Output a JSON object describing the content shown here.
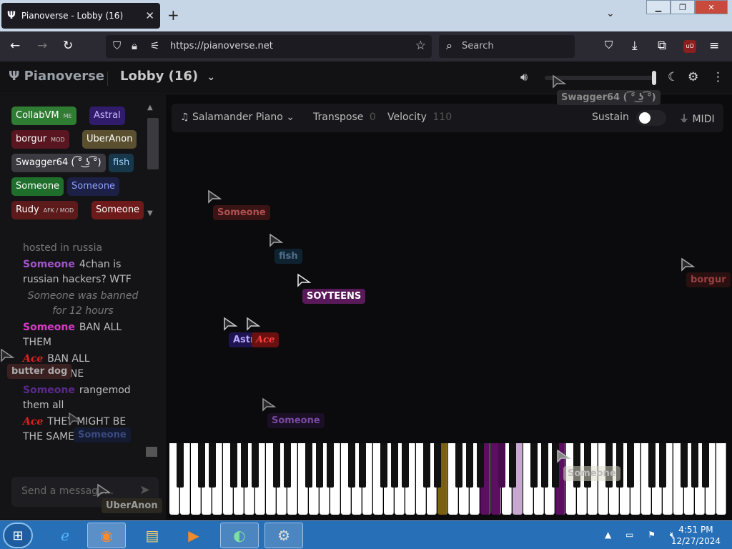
{
  "browser": {
    "tab_title": "Pianoverse - Lobby (16)",
    "tab_favicon": "Ψ",
    "url": "https://pianoverse.net",
    "search_placeholder": "Search"
  },
  "app": {
    "brand": "Pianoverse",
    "room": "Lobby (16)",
    "volume_level": 1.0,
    "volume_label": "Swagger64 ( ͡° ͜ʖ ͡°)"
  },
  "users": [
    {
      "name": "CollabVM",
      "tag": "ME",
      "color": "#2e7d32",
      "text": "#ffffff"
    },
    {
      "name": "Astral",
      "tag": "",
      "color": "#311b6b",
      "text": "#c9b8ff"
    },
    {
      "name": "borgur",
      "tag": "MOD",
      "color": "#5a1620",
      "text": "#ffffff"
    },
    {
      "name": "UberAnon",
      "tag": "",
      "color": "#5a5030",
      "text": "#ffffff"
    },
    {
      "name": "Swagger64 ( ͡° ͜ʖ ͡°)",
      "tag": "",
      "color": "#3a3a40",
      "text": "#ffffff"
    },
    {
      "name": "fish",
      "tag": "",
      "color": "#16384a",
      "text": "#9fd0ff"
    },
    {
      "name": "Someone",
      "tag": "",
      "color": "#1f6e2c",
      "text": "#ffffff"
    },
    {
      "name": "Someone",
      "tag": "",
      "color": "#1c2044",
      "text": "#8fa0ff"
    },
    {
      "name": "Rudy",
      "tag": "AFK / MOD",
      "color": "#5c1a1a",
      "text": "#ffffff"
    },
    {
      "name": "Someone",
      "tag": "",
      "color": "#6e1a1a",
      "text": "#ffffff"
    }
  ],
  "chat": {
    "messages": [
      {
        "nick": "",
        "text": "hosted in russia",
        "nick_color": ""
      },
      {
        "nick": "Someone",
        "text": "4chan is russian hackers? WTF",
        "nick_color": "#a055c8"
      },
      {
        "nick": "",
        "text": "Someone was banned for 12 hours",
        "nick_color": "",
        "system": true
      },
      {
        "nick": "Someone",
        "text": "BAN ALL THEM",
        "nick_color": "#d93cc4"
      },
      {
        "nick": "Ace",
        "text": "BAN ALL @SOMEONE",
        "nick_color": "#e02020"
      },
      {
        "nick": "Someone",
        "text": "rangemod them all",
        "nick_color": "#5a2a8a"
      },
      {
        "nick": "Ace",
        "text": "THEY MIGHT BE THE SAME DUDE",
        "nick_color": "#e02020"
      }
    ],
    "input_placeholder": "Send a message..."
  },
  "toolbar": {
    "instrument": "Salamander Piano",
    "transpose_label": "Transpose",
    "transpose_value": "0",
    "velocity_label": "Velocity",
    "velocity_value": "110",
    "sustain_label": "Sustain",
    "sustain_on": false,
    "midi_label": "MIDI"
  },
  "cursors": {
    "someone1": "Someone",
    "fish": "fish",
    "soyteens": "SOYTEENS",
    "borgur": "borgur",
    "astral": "Astral",
    "ace": "Ace",
    "someone2": "Someone",
    "butterdog": "butter dog",
    "someone3": "Someone",
    "uberanon": "UberAnon",
    "someone_piano": "Someone"
  },
  "taskbar": {
    "time": "4:51 PM",
    "date": "12/27/2024"
  }
}
